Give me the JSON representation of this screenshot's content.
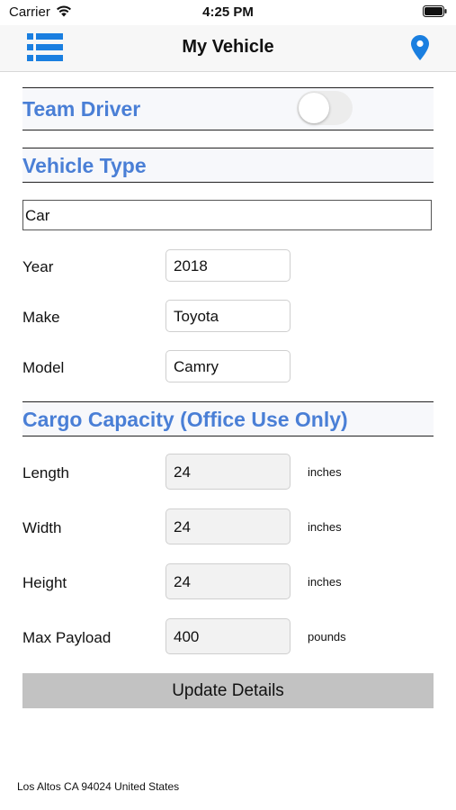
{
  "status_bar": {
    "carrier": "Carrier",
    "time": "4:25 PM"
  },
  "nav": {
    "title": "My Vehicle",
    "menu_icon": "list-icon",
    "location_icon": "location-pin-icon"
  },
  "team_driver": {
    "label": "Team Driver",
    "toggle_on": false
  },
  "vehicle_type": {
    "label": "Vehicle Type",
    "value": "Car"
  },
  "vehicle_fields": [
    {
      "label": "Year",
      "value": "2018"
    },
    {
      "label": "Make",
      "value": "Toyota"
    },
    {
      "label": "Model",
      "value": "Camry"
    }
  ],
  "cargo": {
    "label": "Cargo Capacity (Office Use Only)",
    "fields": [
      {
        "label": "Length",
        "value": "24",
        "unit": "inches"
      },
      {
        "label": "Width",
        "value": "24",
        "unit": "inches"
      },
      {
        "label": "Height",
        "value": "24",
        "unit": "inches"
      },
      {
        "label": "Max Payload",
        "value": "400",
        "unit": "pounds"
      }
    ]
  },
  "update_button": "Update Details",
  "footer": {
    "location": "Los Altos CA 94024 United States"
  },
  "colors": {
    "accent": "#4a7fd6",
    "icon_blue": "#1a7fe0",
    "button_bg": "#c2c2c2"
  }
}
